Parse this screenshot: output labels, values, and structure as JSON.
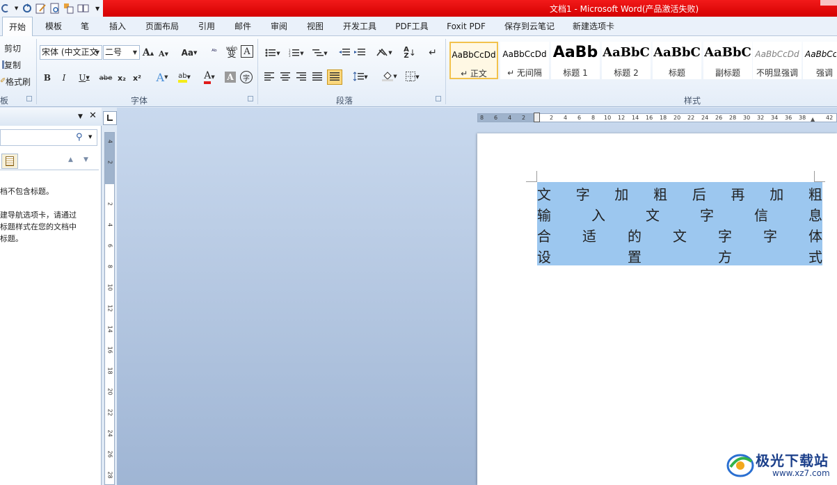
{
  "window": {
    "title": "文档1 - Microsoft Word(产品激活失败)"
  },
  "tabs": [
    {
      "label": "开始",
      "active": true
    },
    {
      "label": "模板"
    },
    {
      "label": "笔"
    },
    {
      "label": "插入"
    },
    {
      "label": "页面布局"
    },
    {
      "label": "引用"
    },
    {
      "label": "邮件"
    },
    {
      "label": "审阅"
    },
    {
      "label": "视图"
    },
    {
      "label": "开发工具"
    },
    {
      "label": "PDF工具"
    },
    {
      "label": "Foxit PDF"
    },
    {
      "label": "保存到云笔记"
    },
    {
      "label": "新建选项卡"
    }
  ],
  "clipboard": {
    "cut": "剪切",
    "copy": "复制",
    "format_painter": "格式刷",
    "label": "板"
  },
  "font": {
    "name": "宋体 (中文正文",
    "size": "二号",
    "label": "字体",
    "bold": "B",
    "italic": "I",
    "underline": "U",
    "strike": "abe",
    "sub": "x₂",
    "sup": "x²",
    "grow": "A",
    "shrink": "A",
    "case": "Aa",
    "phonetic": "wén",
    "phonetic_char": "变",
    "border_char": "A",
    "color_a": "A",
    "shade_a": "A",
    "enclose": "字",
    "highlight": "ab"
  },
  "paragraph": {
    "label": "段落"
  },
  "styles": {
    "label": "样式",
    "items": [
      {
        "sample": "AaBbCcDd",
        "name": "↵ 正文",
        "selected": true
      },
      {
        "sample": "AaBbCcDd",
        "name": "↵ 无间隔"
      },
      {
        "sample": "AaBb",
        "name": "标题 1"
      },
      {
        "sample": "AaBbC",
        "name": "标题 2"
      },
      {
        "sample": "AaBbC",
        "name": "标题"
      },
      {
        "sample": "AaBbC",
        "name": "副标题"
      },
      {
        "sample": "AaBbCcDd",
        "name": "不明显强调"
      },
      {
        "sample": "AaBbCcI",
        "name": "强调"
      }
    ]
  },
  "nav_pane": {
    "text_lines": [
      "档不包含标题。",
      "",
      "建导航选项卡，请通过",
      "标题样式在您的文档中",
      "标题。"
    ]
  },
  "ruler": {
    "h_ticks": [
      "8",
      "6",
      "4",
      "2",
      "2",
      "4",
      "6",
      "8",
      "10",
      "12",
      "14",
      "16",
      "18",
      "20",
      "22",
      "24",
      "26",
      "28",
      "30",
      "32",
      "34",
      "36",
      "38",
      "42"
    ],
    "v_ticks": [
      "4",
      "2",
      "2",
      "4",
      "6",
      "8",
      "10",
      "12",
      "14",
      "16",
      "18",
      "20",
      "22",
      "24",
      "26",
      "28"
    ]
  },
  "document": {
    "lines": [
      [
        "文",
        "字",
        "加",
        "粗",
        "后",
        "再",
        "加",
        "粗"
      ],
      [
        "输",
        "入",
        "文",
        "字",
        "信",
        "息"
      ],
      [
        "合",
        "适",
        "的",
        "文",
        "字",
        "字",
        "体"
      ],
      [
        "设",
        "置",
        "方",
        "式"
      ]
    ]
  },
  "watermark": {
    "title": "极光下载站",
    "url": "www.xz7.com"
  },
  "colors": {
    "title_bar": "#e00000",
    "selection": "#9cc7ef",
    "workspace": "#b5c9e3"
  }
}
